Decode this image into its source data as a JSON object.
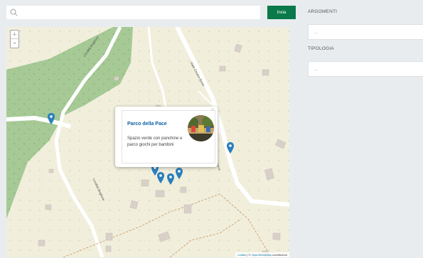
{
  "search": {
    "value": "",
    "placeholder": "",
    "submit_label": "Invia"
  },
  "map": {
    "zoom_in": "+",
    "zoom_out": "-",
    "attribution_leaflet": "Leaflet",
    "attribution_sep": " | © ",
    "attribution_osm": "OpenStreetMap",
    "attribution_tail": " contributors",
    "road_labels": [
      "Località Boglione",
      "Località Boglione",
      "Viale Cesare Bossi",
      "della Serra"
    ],
    "popup": {
      "title": "Parco della Pace",
      "description": "Spazio verde con panchine e parco giochi per bambini",
      "close": "×"
    }
  },
  "filters": {
    "argomenti": {
      "label": "ARGOMENTI",
      "value": "..."
    },
    "tipologia": {
      "label": "TIPOLOGIA",
      "value": "..."
    }
  },
  "colors": {
    "accent": "#0b7a4a",
    "marker": "#2a7fbf",
    "forest": "#9fc58e",
    "land": "#f1eedc",
    "link": "#0b5fa5"
  }
}
